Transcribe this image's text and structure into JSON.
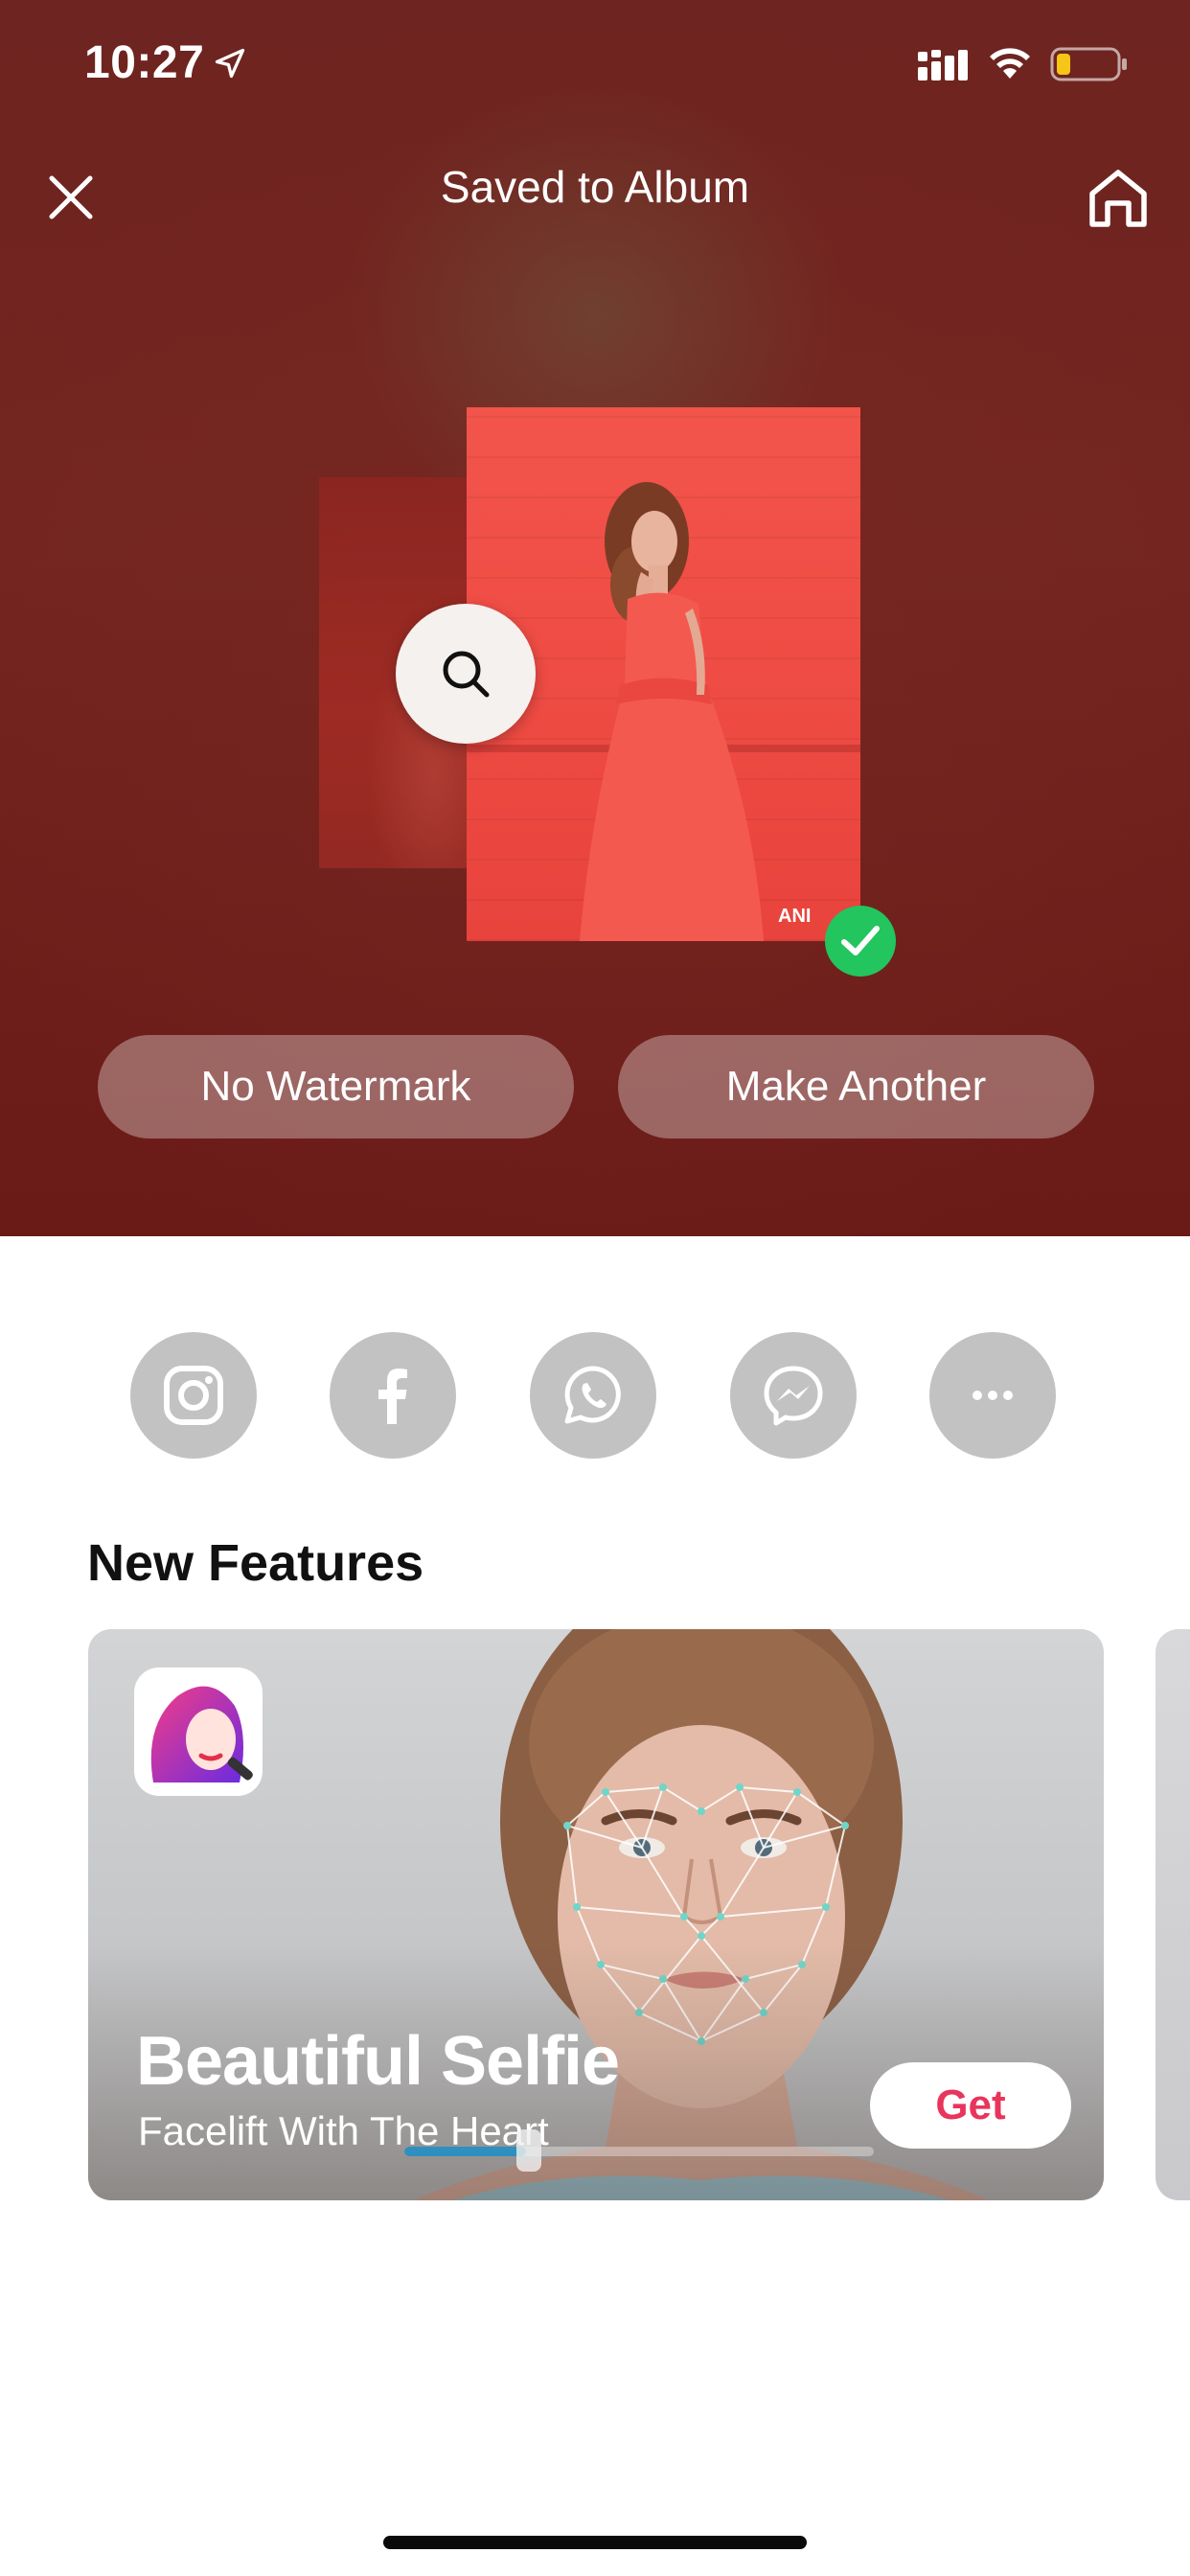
{
  "status_bar": {
    "time": "10:27"
  },
  "header": {
    "title": "Saved to Album"
  },
  "preview": {
    "watermark_text": "ANI"
  },
  "actions": {
    "no_watermark_label": "No Watermark",
    "make_another_label": "Make Another"
  },
  "share": {
    "buttons": [
      "instagram-icon",
      "facebook-icon",
      "whatsapp-icon",
      "messenger-icon",
      "more-icon"
    ]
  },
  "new_features": {
    "title": "New Features",
    "card": {
      "title": "Beautiful Selfie",
      "subtitle": "Facelift With The Heart",
      "get_label": "Get",
      "progress": 0.26
    }
  },
  "colors": {
    "header_bg": "#6e2420",
    "accent_get": "#e8355c",
    "share_btn": "#c2c2c2",
    "check": "#22c55e"
  }
}
